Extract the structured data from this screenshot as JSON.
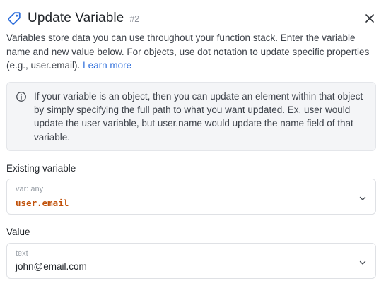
{
  "header": {
    "title": "Update Variable",
    "step": "#2"
  },
  "description": {
    "text": "Variables store data you can use throughout your function stack. Enter the variable name and new value below. For objects, use dot notation to update specific properties (e.g., user.email).",
    "link": "Learn more"
  },
  "info": {
    "text": "If your variable is an object, then you can update an element within that object by simply specifying the full path to what you want updated. Ex. user would update the user variable, but user.name would update the name field of that variable."
  },
  "existing_variable": {
    "label": "Existing variable",
    "hint": "var: any",
    "value": "user.email"
  },
  "value_field": {
    "label": "Value",
    "hint": "text",
    "value": "john@email.com"
  },
  "colors": {
    "link": "#2f6fdb",
    "variable": "#c0510a",
    "icon": "#2f6fdb"
  },
  "icons": {
    "title": "tag-icon",
    "close": "close-icon",
    "info": "info-icon",
    "dropdown": "chevron-down-icon"
  }
}
